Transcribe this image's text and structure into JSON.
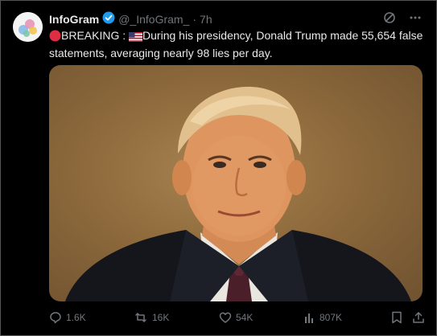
{
  "tweet": {
    "author_name": "InfoGram",
    "handle": "@_InfoGram_",
    "separator": "·",
    "time": "7h",
    "verified_icon": "verified-badge-icon",
    "text_prefix": "BREAKING : ",
    "text_body": "During his presidency, Donald Trump made 55,654 false statements, averaging nearly 98 lies per day.",
    "media": {
      "description": "Photo"
    }
  },
  "actions": {
    "replies": "1.6K",
    "reposts": "16K",
    "likes": "54K",
    "views": "807K"
  },
  "colors": {
    "background": "#000000",
    "text": "#e7e9ea",
    "muted": "#71767b",
    "verified": "#1d9bf0",
    "red_circle": "#dd2e44"
  }
}
